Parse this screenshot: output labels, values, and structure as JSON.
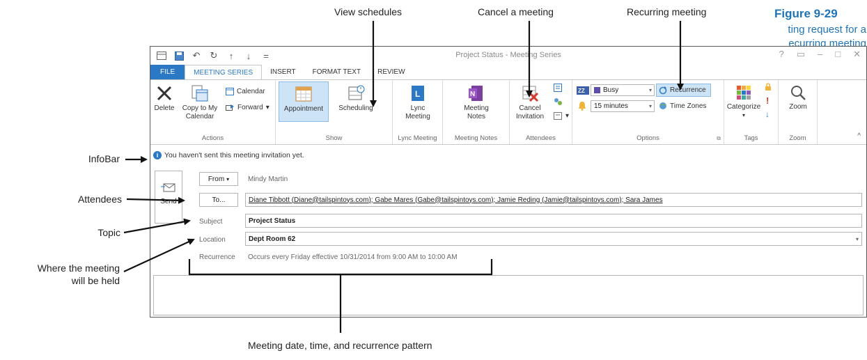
{
  "figure": {
    "title": "Figure 9-29",
    "caption_line1": "ting request for a",
    "caption_line2": "ecurring meeting"
  },
  "callouts": {
    "view_schedules": "View schedules",
    "cancel_meeting": "Cancel a meeting",
    "recurring_meeting": "Recurring meeting",
    "infobar": "InfoBar",
    "attendees": "Attendees",
    "topic": "Topic",
    "where_line1": "Where the meeting",
    "where_line2": "will be held",
    "meeting_date": "Meeting date, time, and recurrence pattern"
  },
  "window": {
    "title": "Project Status - Meeting Series",
    "controls": {
      "help": "?",
      "restore": "▭",
      "minimize": "–",
      "maximize": "□",
      "close": "✕"
    }
  },
  "tabs": [
    {
      "label": "FILE"
    },
    {
      "label": "MEETING SERIES"
    },
    {
      "label": "INSERT"
    },
    {
      "label": "FORMAT TEXT"
    },
    {
      "label": "REVIEW"
    }
  ],
  "ribbon": {
    "actions": {
      "label": "Actions",
      "delete": "Delete",
      "copy_line1": "Copy to My",
      "copy_line2": "Calendar",
      "calendar": "Calendar",
      "forward": "Forward"
    },
    "show": {
      "label": "Show",
      "appointment": "Appointment",
      "scheduling": "Scheduling"
    },
    "lync": {
      "label": "Lync Meeting",
      "btn_line1": "Lync",
      "btn_line2": "Meeting"
    },
    "notes": {
      "label": "Meeting Notes",
      "btn_line1": "Meeting",
      "btn_line2": "Notes"
    },
    "attendees": {
      "label": "Attendees",
      "cancel_line1": "Cancel",
      "cancel_line2": "Invitation"
    },
    "options": {
      "label": "Options",
      "show_as": "Busy",
      "reminder": "15 minutes",
      "recurrence": "Recurrence",
      "time_zones": "Time Zones"
    },
    "tags": {
      "label": "Tags",
      "categorize": "Categorize"
    },
    "zoom": {
      "label": "Zoom",
      "zoom": "Zoom"
    }
  },
  "form": {
    "infobar": "You haven't sent this meeting invitation yet.",
    "send": "Send",
    "from_button": "From",
    "from_value": "Mindy Martin",
    "to_button": "To...",
    "to_value": "Diane Tibbott (Diane@tailspintoys.com); Gabe Mares (Gabe@tailspintoys.com); Jamie Reding (Jamie@tailspintoys.com); Sara James",
    "subject_label": "Subject",
    "subject_value": "Project Status",
    "location_label": "Location",
    "location_value": "Dept Room 62",
    "recurrence_label": "Recurrence",
    "recurrence_value": "Occurs every Friday effective 10/31/2014 from 9:00 AM to 10:00 AM"
  }
}
